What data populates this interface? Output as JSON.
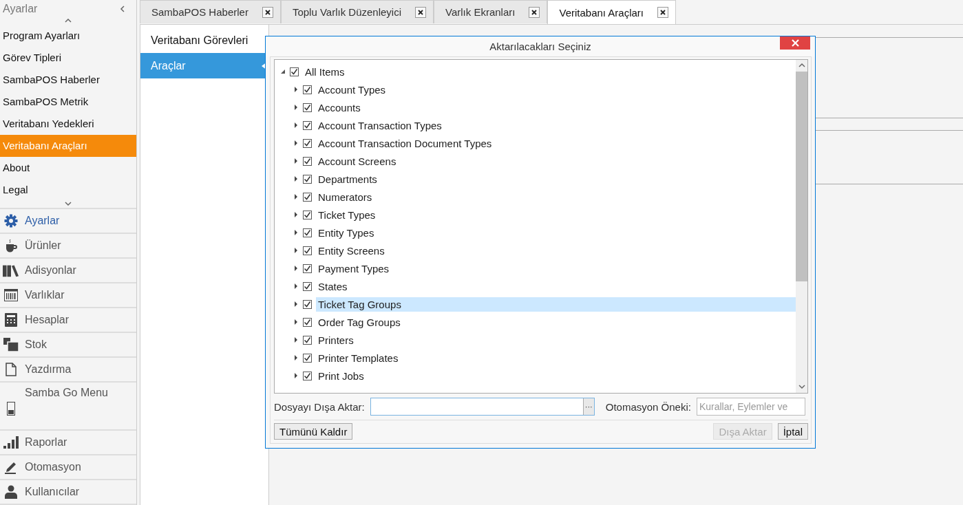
{
  "sidebar": {
    "title": "Ayarlar",
    "settings_items": [
      {
        "label": "Program Ayarları",
        "selected": false
      },
      {
        "label": "Görev Tipleri",
        "selected": false
      },
      {
        "label": "SambaPOS Haberler",
        "selected": false
      },
      {
        "label": "SambaPOS Metrik",
        "selected": false
      },
      {
        "label": "Veritabanı Yedekleri",
        "selected": false
      },
      {
        "label": "Veritabanı Araçları",
        "selected": true
      },
      {
        "label": "About",
        "selected": false
      },
      {
        "label": "Legal",
        "selected": false
      }
    ],
    "nav": [
      {
        "label": "Ayarlar",
        "kind": "gear",
        "selected": true
      },
      {
        "label": "Ürünler",
        "kind": "cup",
        "selected": false
      },
      {
        "label": "Adisyonlar",
        "kind": "books",
        "selected": false
      },
      {
        "label": "Varlıklar",
        "kind": "barcode",
        "selected": false
      },
      {
        "label": "Hesaplar",
        "kind": "calculator",
        "selected": false
      },
      {
        "label": "Stok",
        "kind": "stack",
        "selected": false
      },
      {
        "label": "Yazdırma",
        "kind": "document",
        "selected": false
      },
      {
        "label": "Samba Go Menu",
        "kind": "phone",
        "selected": false
      },
      {
        "label": "Raporlar",
        "kind": "bars",
        "selected": false
      },
      {
        "label": "Otomasyon",
        "kind": "pen",
        "selected": false
      },
      {
        "label": "Kullanıcılar",
        "kind": "user",
        "selected": false
      }
    ]
  },
  "tabs": [
    {
      "label": "SambaPOS Haberler",
      "selected": false
    },
    {
      "label": "Toplu Varlık Düzenleyici",
      "selected": false
    },
    {
      "label": "Varlık Ekranları",
      "selected": false
    },
    {
      "label": "Veritabanı Araçları",
      "selected": true
    }
  ],
  "subnav": [
    {
      "label": "Veritabanı Görevleri",
      "selected": false
    },
    {
      "label": "Araçlar",
      "selected": true
    }
  ],
  "dialog": {
    "title": "Aktarılacakları Seçiniz",
    "tree": {
      "label": "All Items",
      "checked": true,
      "expanded": true,
      "children": [
        {
          "label": "Account Types",
          "checked": true,
          "expanded": false,
          "selected": false
        },
        {
          "label": "Accounts",
          "checked": true,
          "expanded": false,
          "selected": false
        },
        {
          "label": "Account Transaction Types",
          "checked": true,
          "expanded": false,
          "selected": false
        },
        {
          "label": "Account Transaction Document Types",
          "checked": true,
          "expanded": false,
          "selected": false
        },
        {
          "label": "Account Screens",
          "checked": true,
          "expanded": false,
          "selected": false
        },
        {
          "label": "Departments",
          "checked": true,
          "expanded": false,
          "selected": false
        },
        {
          "label": "Numerators",
          "checked": true,
          "expanded": false,
          "selected": false
        },
        {
          "label": "Ticket Types",
          "checked": true,
          "expanded": false,
          "selected": false
        },
        {
          "label": "Entity Types",
          "checked": true,
          "expanded": false,
          "selected": false
        },
        {
          "label": "Entity Screens",
          "checked": true,
          "expanded": false,
          "selected": false
        },
        {
          "label": "Payment Types",
          "checked": true,
          "expanded": false,
          "selected": false
        },
        {
          "label": "States",
          "checked": true,
          "expanded": false,
          "selected": false
        },
        {
          "label": "Ticket Tag Groups",
          "checked": true,
          "expanded": false,
          "selected": true
        },
        {
          "label": "Order Tag Groups",
          "checked": true,
          "expanded": false,
          "selected": false
        },
        {
          "label": "Printers",
          "checked": true,
          "expanded": false,
          "selected": false
        },
        {
          "label": "Printer Templates",
          "checked": true,
          "expanded": false,
          "selected": false
        },
        {
          "label": "Print Jobs",
          "checked": true,
          "expanded": false,
          "selected": false
        }
      ]
    },
    "export_label": "Dosyayı Dışa Aktar:",
    "browse_glyph": "···",
    "prefix_label": "Otomasyon Öneki:",
    "prefix_placeholder": "Kurallar, Eylemler ve",
    "buttons": [
      {
        "label": "Tümünü Kaldır",
        "disabled": false,
        "kind": "left"
      },
      {
        "label": "Dışa Aktar",
        "disabled": true,
        "kind": "right"
      },
      {
        "label": "İptal",
        "disabled": false,
        "kind": "right"
      }
    ]
  }
}
